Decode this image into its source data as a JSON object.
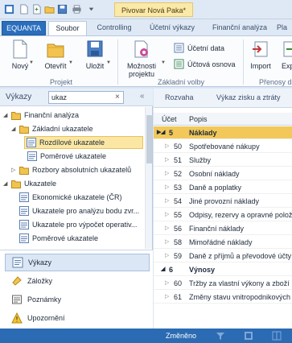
{
  "app": {
    "title": "Pivovar Nová Paka*"
  },
  "ribbon_tabs": [
    {
      "label": "EQUANTA"
    },
    {
      "label": "Soubor"
    },
    {
      "label": "Controlling"
    },
    {
      "label": "Účetní výkazy"
    },
    {
      "label": "Finanční analýza"
    },
    {
      "label": "Pla"
    }
  ],
  "ribbon": {
    "novy": "Nový",
    "otevrit": "Otevřít",
    "ulozit": "Uložit",
    "moznosti_1": "Možnosti",
    "moznosti_2": "projektu",
    "ucetni_data": "Účetní data",
    "uctova_osnova": "Účtová osnova",
    "import": "Import",
    "export": "Exp",
    "group_projekt": "Projekt",
    "group_zakladni": "Základní volby",
    "group_prenosy": "Přenosy da"
  },
  "left_panel": {
    "title": "Výkazy",
    "search_value": "ukaz",
    "tree": [
      {
        "label": "Finanční analýza"
      },
      {
        "label": "Základní ukazatele"
      },
      {
        "label": "Rozdílové ukazatele"
      },
      {
        "label": "Poměrové ukazatele"
      },
      {
        "label": "Rozbory absolutních ukazatelů"
      },
      {
        "label": "Ukazatele"
      },
      {
        "label": "Ekonomické ukazatele (ČR)"
      },
      {
        "label": "Ukazatele pro analýzu bodu zvr..."
      },
      {
        "label": "Ukazatele pro výpočet operativ..."
      },
      {
        "label": "Poměrové ukazatele"
      }
    ],
    "nav": [
      {
        "label": "Výkazy"
      },
      {
        "label": "Záložky"
      },
      {
        "label": "Poznámky"
      },
      {
        "label": "Upozornění"
      }
    ]
  },
  "right_panel": {
    "tabs": [
      "Rozvaha",
      "Výkaz zisku a ztráty"
    ],
    "columns": {
      "ucet": "Účet",
      "popis": "Popis"
    },
    "rows": [
      {
        "ucet": "5",
        "popis": "Náklady"
      },
      {
        "ucet": "50",
        "popis": "Spotřebované nákupy"
      },
      {
        "ucet": "51",
        "popis": "Služby"
      },
      {
        "ucet": "52",
        "popis": "Osobní náklady"
      },
      {
        "ucet": "53",
        "popis": "Daně a poplatky"
      },
      {
        "ucet": "54",
        "popis": "Jiné provozní náklady"
      },
      {
        "ucet": "55",
        "popis": "Odpisy, rezervy a opravné polož"
      },
      {
        "ucet": "56",
        "popis": "Finanční náklady"
      },
      {
        "ucet": "58",
        "popis": "Mimořádné náklady"
      },
      {
        "ucet": "59",
        "popis": "Daně z příjmů a převodové účty"
      },
      {
        "ucet": "6",
        "popis": "Výnosy"
      },
      {
        "ucet": "60",
        "popis": "Tržby za vlastní výkony a zboží"
      },
      {
        "ucet": "61",
        "popis": "Změny stavu vnitropodnikových"
      }
    ]
  },
  "status": {
    "text": "Změněno"
  },
  "colors": {
    "accent": "#2b6bb3",
    "selection": "#f2c85a",
    "brand_tab": "#2a6ebd"
  }
}
